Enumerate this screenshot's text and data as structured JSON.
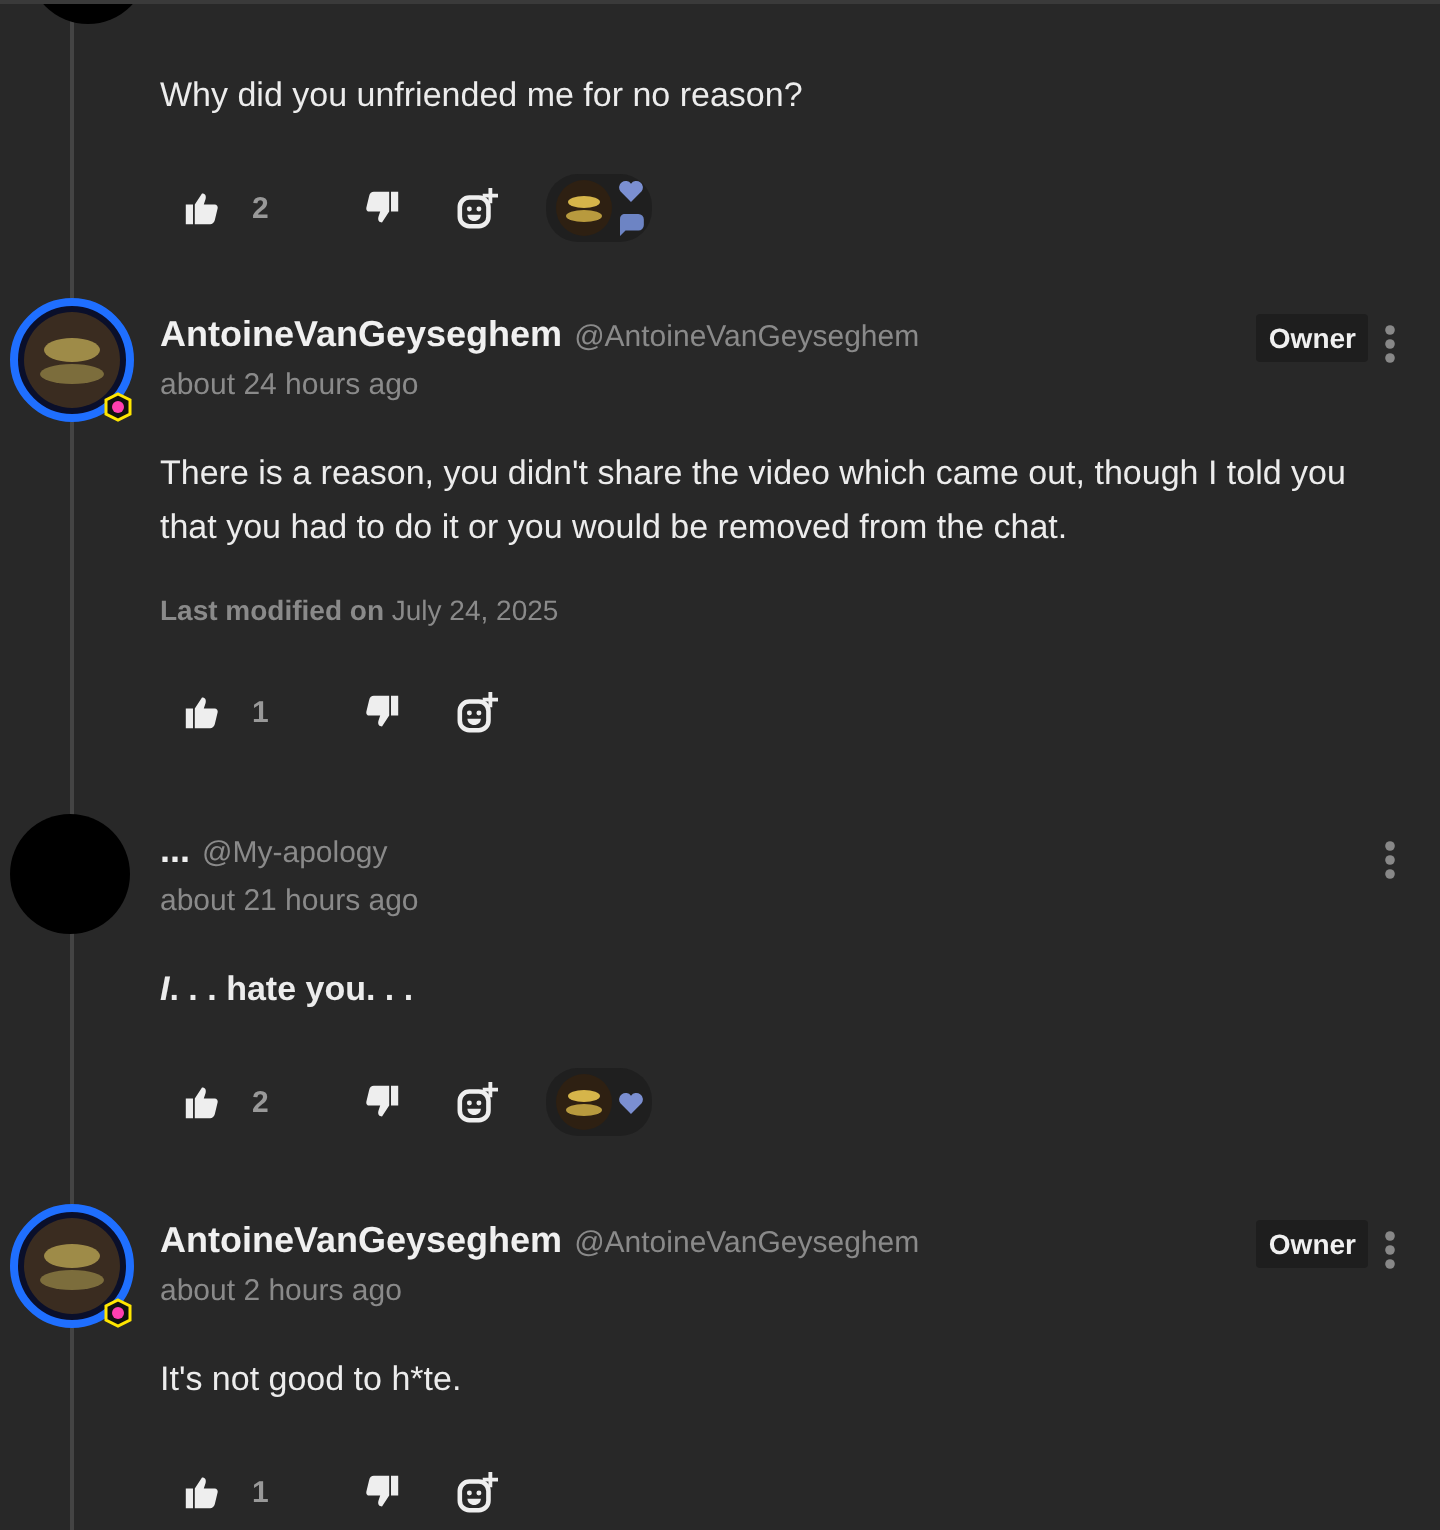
{
  "comments": [
    {
      "avatar": {
        "kind": "plain"
      },
      "cut_top": true,
      "body": "Why did you unfriended me for no reason?",
      "likes": "2",
      "reactions": [
        {
          "kind": "heart"
        },
        {
          "kind": "comment"
        }
      ]
    },
    {
      "avatar": {
        "kind": "ring"
      },
      "name": "AntoineVanGeyseghem",
      "handle": "@AntoineVanGeyseghem",
      "badge": "Owner",
      "time": "about 24 hours ago",
      "body": "There is a reason, you didn't share the video which came out, though I told you that you had to do it or you would be removed from the chat.",
      "modified": {
        "label": "Last modified on",
        "date": "July 24, 2025"
      },
      "likes": "1"
    },
    {
      "avatar": {
        "kind": "plain"
      },
      "name": "...",
      "handle": "@My-apology",
      "time": "about 21 hours ago",
      "body": "*I*. . . hate you. . .",
      "body_bold": true,
      "likes": "2",
      "reactions": [
        {
          "kind": "heart"
        }
      ]
    },
    {
      "avatar": {
        "kind": "ring"
      },
      "name": "AntoineVanGeyseghem",
      "handle": "@AntoineVanGeyseghem",
      "badge": "Owner",
      "time": "about 2 hours ago",
      "body": "It's not good to h*te.",
      "likes": "1"
    }
  ]
}
